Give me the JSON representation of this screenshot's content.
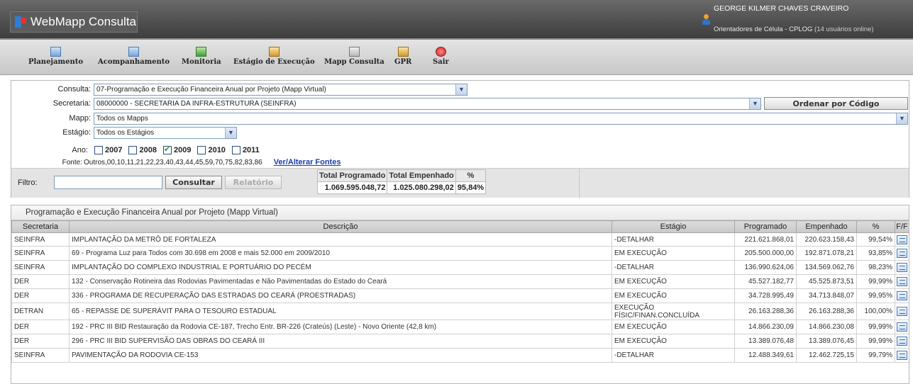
{
  "app": {
    "title": "WebMapp Consulta"
  },
  "user": {
    "name": "GEORGE KILMER CHAVES CRAVEIRO",
    "unit": "Orientadores de Célula - CPLOG",
    "online": "(14 usuários online)"
  },
  "menu": {
    "items": [
      {
        "label": "Planejamento",
        "icon": "planning-icon"
      },
      {
        "label": "Acompanhamento",
        "icon": "tracking-icon"
      },
      {
        "label": "Monitoria",
        "icon": "monitoring-icon"
      },
      {
        "label": "Estágio de Execução",
        "icon": "execution-stage-icon"
      },
      {
        "label": "Mapp Consulta",
        "icon": "mapp-query-icon"
      },
      {
        "label": "GPR",
        "icon": "gpr-icon"
      },
      {
        "label": "Sair",
        "icon": "exit-icon"
      }
    ]
  },
  "form": {
    "consulta": {
      "label": "Consulta:",
      "value": "07-Programação e Execução Financeira Anual por Projeto (Mapp Virtual)"
    },
    "secretaria": {
      "label": "Secretaria:",
      "value": "08000000 - SECRETARIA DA INFRA-ESTRUTURA (SEINFRA)"
    },
    "order_button": "Ordenar por Código",
    "mapp": {
      "label": "Mapp:",
      "value": "Todos os Mapps"
    },
    "estagio": {
      "label": "Estágio:",
      "value": "Todos os Estágios"
    },
    "ano": {
      "label": "Ano:",
      "years": [
        {
          "year": "2007",
          "checked": false
        },
        {
          "year": "2008",
          "checked": false
        },
        {
          "year": "2009",
          "checked": true
        },
        {
          "year": "2010",
          "checked": false
        },
        {
          "year": "2011",
          "checked": false
        }
      ]
    },
    "fonte": {
      "label": "Fonte:",
      "value": "Outros,00,10,11,21,22,23,40,43,44,45,59,70,75,82,83,86",
      "link": "Ver/Alterar Fontes"
    }
  },
  "filter": {
    "label": "Filtro:",
    "value": "",
    "consultar": "Consultar",
    "relatorio": "Relatório"
  },
  "totals": {
    "headers": [
      "Total Programado",
      "Total Empenhado",
      "%"
    ],
    "values": [
      "1.069.595.048,72",
      "1.025.080.298,02",
      "95,84%"
    ]
  },
  "grid": {
    "title": "Programação e Execução Financeira Anual por Projeto (Mapp Virtual)",
    "columns": [
      "Secretaria",
      "Descrição",
      "Estágio",
      "Programado",
      "Empenhado",
      "%",
      "F/F"
    ],
    "rows": [
      {
        "sec": "SEINFRA",
        "desc": "IMPLANTAÇÃO DA METRÔ DE FORTALEZA",
        "est": "-DETALHAR",
        "prog": "221.621.868,01",
        "emp": "220.623.158,43",
        "pct": "99,54%"
      },
      {
        "sec": "SEINFRA",
        "desc": "69 - Programa Luz para Todos com 30.698 em 2008 e mais 52.000 em 2009/2010",
        "est": "EM EXECUÇÃO",
        "prog": "205.500.000,00",
        "emp": "192.871.078,21",
        "pct": "93,85%"
      },
      {
        "sec": "SEINFRA",
        "desc": "IMPLANTAÇÃO DO COMPLEXO INDUSTRIAL E PORTUÁRIO DO PECÉM",
        "est": "-DETALHAR",
        "prog": "136.990.624,06",
        "emp": "134.569.062,76",
        "pct": "98,23%"
      },
      {
        "sec": "DER",
        "desc": "132 - Conservação Rotineira das Rodovias Pavimentadas e Não Pavimentadas do Estado do Ceará",
        "est": "EM EXECUÇÃO",
        "prog": "45.527.182,77",
        "emp": "45.525.873,51",
        "pct": "99,99%"
      },
      {
        "sec": "DER",
        "desc": "336 - PROGRAMA DE RECUPERAÇÃO DAS ESTRADAS DO CEARÁ (PROESTRADAS)",
        "est": "EM EXECUÇÃO",
        "prog": "34.728.995,49",
        "emp": "34.713.848,07",
        "pct": "99,95%"
      },
      {
        "sec": "DETRAN",
        "desc": "65 - REPASSE DE SUPERÁVIT PARA O TESOURO ESTADUAL",
        "est": "EXECUÇÃO FÍSIC/FINAN.CONCLUÍDA",
        "prog": "26.163.288,36",
        "emp": "26.163.288,36",
        "pct": "100,00%"
      },
      {
        "sec": "DER",
        "desc": "192 - PRC III BID Restauração da Rodovia CE-187, Trecho Entr. BR-226 (Crateús) (Leste) - Novo Oriente (42,8 km)",
        "est": "EM EXECUÇÃO",
        "prog": "14.866.230,09",
        "emp": "14.866.230,08",
        "pct": "99,99%"
      },
      {
        "sec": "DER",
        "desc": "296 - PRC III BID SUPERVISÃO DAS OBRAS DO CEARÁ III",
        "est": "EM EXECUÇÃO",
        "prog": "13.389.076,48",
        "emp": "13.389.076,45",
        "pct": "99,99%"
      },
      {
        "sec": "SEINFRA",
        "desc": "PAVIMENTAÇÃO DA RODOVIA CE-153",
        "est": "-DETALHAR",
        "prog": "12.488.349,61",
        "emp": "12.462.725,15",
        "pct": "99,79%"
      }
    ]
  }
}
